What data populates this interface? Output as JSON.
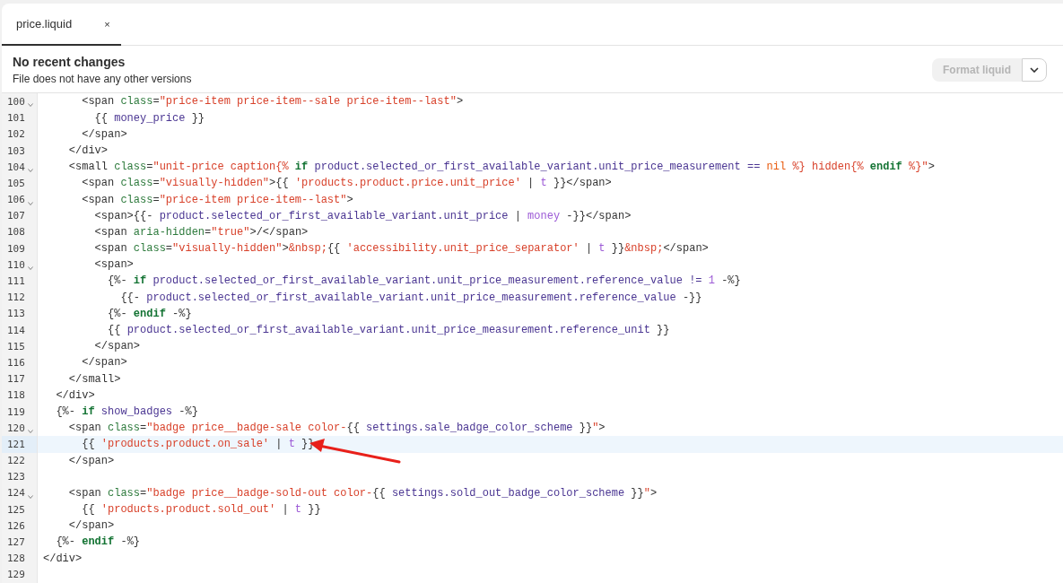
{
  "tabs": [
    {
      "label": "price.liquid",
      "close": "×",
      "selected": true
    }
  ],
  "history": {
    "title": "No recent changes",
    "subtitle": "File does not have any other versions"
  },
  "format_button": {
    "label": "Format liquid",
    "disabled": true
  },
  "editor": {
    "lines": [
      {
        "number": "100",
        "foldable": true,
        "highlighted": false,
        "tokens": [
          {
            "kind": "plain",
            "text": "      <span "
          },
          {
            "kind": "attr",
            "text": "class"
          },
          {
            "kind": "plain",
            "text": "="
          },
          {
            "kind": "string",
            "text": "\"price-item price-item--sale price-item--last\""
          },
          {
            "kind": "plain",
            "text": ">"
          }
        ]
      },
      {
        "number": "101",
        "foldable": false,
        "highlighted": false,
        "tokens": [
          {
            "kind": "plain",
            "text": "        {{ "
          },
          {
            "kind": "variable",
            "text": "money_price"
          },
          {
            "kind": "plain",
            "text": " }}"
          }
        ]
      },
      {
        "number": "102",
        "foldable": false,
        "highlighted": false,
        "tokens": [
          {
            "kind": "plain",
            "text": "      </span>"
          }
        ]
      },
      {
        "number": "103",
        "foldable": false,
        "highlighted": false,
        "tokens": [
          {
            "kind": "plain",
            "text": "    </div>"
          }
        ]
      },
      {
        "number": "104",
        "foldable": true,
        "highlighted": false,
        "tokens": [
          {
            "kind": "plain",
            "text": "    <small "
          },
          {
            "kind": "attr",
            "text": "class"
          },
          {
            "kind": "plain",
            "text": "="
          },
          {
            "kind": "string",
            "text": "\"unit-price caption{%"
          },
          {
            "kind": "keyword",
            "text": " if"
          },
          {
            "kind": "variable",
            "text": " product.selected_or_first_available_variant.unit_price_measurement == "
          },
          {
            "kind": "literal",
            "text": "nil"
          },
          {
            "kind": "string",
            "text": " %} hidden{%"
          },
          {
            "kind": "keyword",
            "text": " endif"
          },
          {
            "kind": "string",
            "text": " %}\""
          },
          {
            "kind": "plain",
            "text": ">"
          }
        ]
      },
      {
        "number": "105",
        "foldable": false,
        "highlighted": false,
        "tokens": [
          {
            "kind": "plain",
            "text": "      <span "
          },
          {
            "kind": "attr",
            "text": "class"
          },
          {
            "kind": "plain",
            "text": "="
          },
          {
            "kind": "string",
            "text": "\"visually-hidden\""
          },
          {
            "kind": "plain",
            "text": ">{{ "
          },
          {
            "kind": "string",
            "text": "'products.product.price.unit_price'"
          },
          {
            "kind": "plain",
            "text": " | "
          },
          {
            "kind": "filter",
            "text": "t"
          },
          {
            "kind": "plain",
            "text": " }}</span>"
          }
        ]
      },
      {
        "number": "106",
        "foldable": true,
        "highlighted": false,
        "tokens": [
          {
            "kind": "plain",
            "text": "      <span "
          },
          {
            "kind": "attr",
            "text": "class"
          },
          {
            "kind": "plain",
            "text": "="
          },
          {
            "kind": "string",
            "text": "\"price-item price-item--last\""
          },
          {
            "kind": "plain",
            "text": ">"
          }
        ]
      },
      {
        "number": "107",
        "foldable": false,
        "highlighted": false,
        "tokens": [
          {
            "kind": "plain",
            "text": "        <span>{{- "
          },
          {
            "kind": "variable",
            "text": "product.selected_or_first_available_variant.unit_price"
          },
          {
            "kind": "plain",
            "text": " | "
          },
          {
            "kind": "filter",
            "text": "money"
          },
          {
            "kind": "plain",
            "text": " -}}</span>"
          }
        ]
      },
      {
        "number": "108",
        "foldable": false,
        "highlighted": false,
        "tokens": [
          {
            "kind": "plain",
            "text": "        <span "
          },
          {
            "kind": "attr",
            "text": "aria-hidden"
          },
          {
            "kind": "plain",
            "text": "="
          },
          {
            "kind": "string",
            "text": "\"true\""
          },
          {
            "kind": "plain",
            "text": ">/</span>"
          }
        ]
      },
      {
        "number": "109",
        "foldable": false,
        "highlighted": false,
        "tokens": [
          {
            "kind": "plain",
            "text": "        <span "
          },
          {
            "kind": "attr",
            "text": "class"
          },
          {
            "kind": "plain",
            "text": "="
          },
          {
            "kind": "string",
            "text": "\"visually-hidden\""
          },
          {
            "kind": "plain",
            "text": ">"
          },
          {
            "kind": "string",
            "text": "&nbsp;"
          },
          {
            "kind": "plain",
            "text": "{{ "
          },
          {
            "kind": "string",
            "text": "'accessibility.unit_price_separator'"
          },
          {
            "kind": "plain",
            "text": " | "
          },
          {
            "kind": "filter",
            "text": "t"
          },
          {
            "kind": "plain",
            "text": " }}"
          },
          {
            "kind": "string",
            "text": "&nbsp;"
          },
          {
            "kind": "plain",
            "text": "</span>"
          }
        ]
      },
      {
        "number": "110",
        "foldable": true,
        "highlighted": false,
        "tokens": [
          {
            "kind": "plain",
            "text": "        <span>"
          }
        ]
      },
      {
        "number": "111",
        "foldable": false,
        "highlighted": false,
        "tokens": [
          {
            "kind": "plain",
            "text": "          {%- "
          },
          {
            "kind": "keyword",
            "text": "if"
          },
          {
            "kind": "variable",
            "text": " product.selected_or_first_available_variant.unit_price_measurement.reference_value != "
          },
          {
            "kind": "filter",
            "text": "1"
          },
          {
            "kind": "plain",
            "text": " -%}"
          }
        ]
      },
      {
        "number": "112",
        "foldable": false,
        "highlighted": false,
        "tokens": [
          {
            "kind": "plain",
            "text": "            {{- "
          },
          {
            "kind": "variable",
            "text": "product.selected_or_first_available_variant.unit_price_measurement.reference_value"
          },
          {
            "kind": "plain",
            "text": " -}}"
          }
        ]
      },
      {
        "number": "113",
        "foldable": false,
        "highlighted": false,
        "tokens": [
          {
            "kind": "plain",
            "text": "          {%- "
          },
          {
            "kind": "keyword",
            "text": "endif"
          },
          {
            "kind": "plain",
            "text": " -%}"
          }
        ]
      },
      {
        "number": "114",
        "foldable": false,
        "highlighted": false,
        "tokens": [
          {
            "kind": "plain",
            "text": "          {{ "
          },
          {
            "kind": "variable",
            "text": "product.selected_or_first_available_variant.unit_price_measurement.reference_unit"
          },
          {
            "kind": "plain",
            "text": " }}"
          }
        ]
      },
      {
        "number": "115",
        "foldable": false,
        "highlighted": false,
        "tokens": [
          {
            "kind": "plain",
            "text": "        </span>"
          }
        ]
      },
      {
        "number": "116",
        "foldable": false,
        "highlighted": false,
        "tokens": [
          {
            "kind": "plain",
            "text": "      </span>"
          }
        ]
      },
      {
        "number": "117",
        "foldable": false,
        "highlighted": false,
        "tokens": [
          {
            "kind": "plain",
            "text": "    </small>"
          }
        ]
      },
      {
        "number": "118",
        "foldable": false,
        "highlighted": false,
        "tokens": [
          {
            "kind": "plain",
            "text": "  </div>"
          }
        ]
      },
      {
        "number": "119",
        "foldable": false,
        "highlighted": false,
        "tokens": [
          {
            "kind": "plain",
            "text": "  {%- "
          },
          {
            "kind": "keyword",
            "text": "if"
          },
          {
            "kind": "variable",
            "text": " show_badges"
          },
          {
            "kind": "plain",
            "text": " -%}"
          }
        ]
      },
      {
        "number": "120",
        "foldable": true,
        "highlighted": false,
        "tokens": [
          {
            "kind": "plain",
            "text": "    <span "
          },
          {
            "kind": "attr",
            "text": "class"
          },
          {
            "kind": "plain",
            "text": "="
          },
          {
            "kind": "string",
            "text": "\"badge price__badge-sale color-"
          },
          {
            "kind": "plain",
            "text": "{{ "
          },
          {
            "kind": "variable",
            "text": "settings.sale_badge_color_scheme"
          },
          {
            "kind": "plain",
            "text": " }}"
          },
          {
            "kind": "string",
            "text": "\""
          },
          {
            "kind": "plain",
            "text": ">"
          }
        ]
      },
      {
        "number": "121",
        "foldable": false,
        "highlighted": true,
        "tokens": [
          {
            "kind": "plain",
            "text": "      {{ "
          },
          {
            "kind": "string",
            "text": "'products.product.on_sale'"
          },
          {
            "kind": "plain",
            "text": " | "
          },
          {
            "kind": "filter",
            "text": "t"
          },
          {
            "kind": "plain",
            "text": " }}"
          }
        ]
      },
      {
        "number": "122",
        "foldable": false,
        "highlighted": false,
        "tokens": [
          {
            "kind": "plain",
            "text": "    </span>"
          }
        ]
      },
      {
        "number": "123",
        "foldable": false,
        "highlighted": false
      },
      {
        "number": "124",
        "foldable": true,
        "highlighted": false,
        "tokens": [
          {
            "kind": "plain",
            "text": "    <span "
          },
          {
            "kind": "attr",
            "text": "class"
          },
          {
            "kind": "plain",
            "text": "="
          },
          {
            "kind": "string",
            "text": "\"badge price__badge-sold-out color-"
          },
          {
            "kind": "plain",
            "text": "{{ "
          },
          {
            "kind": "variable",
            "text": "settings.sold_out_badge_color_scheme"
          },
          {
            "kind": "plain",
            "text": " }}"
          },
          {
            "kind": "string",
            "text": "\""
          },
          {
            "kind": "plain",
            "text": ">"
          }
        ]
      },
      {
        "number": "125",
        "foldable": false,
        "highlighted": false,
        "tokens": [
          {
            "kind": "plain",
            "text": "      {{ "
          },
          {
            "kind": "string",
            "text": "'products.product.sold_out'"
          },
          {
            "kind": "plain",
            "text": " | "
          },
          {
            "kind": "filter",
            "text": "t"
          },
          {
            "kind": "plain",
            "text": " }}"
          }
        ]
      },
      {
        "number": "126",
        "foldable": false,
        "highlighted": false,
        "tokens": [
          {
            "kind": "plain",
            "text": "    </span>"
          }
        ]
      },
      {
        "number": "127",
        "foldable": false,
        "highlighted": false,
        "tokens": [
          {
            "kind": "plain",
            "text": "  {%- "
          },
          {
            "kind": "keyword",
            "text": "endif"
          },
          {
            "kind": "plain",
            "text": " -%}"
          }
        ]
      },
      {
        "number": "128",
        "foldable": false,
        "highlighted": false,
        "tokens": [
          {
            "kind": "plain",
            "text": "</div>"
          }
        ]
      },
      {
        "number": "129",
        "foldable": false,
        "highlighted": false
      }
    ]
  }
}
